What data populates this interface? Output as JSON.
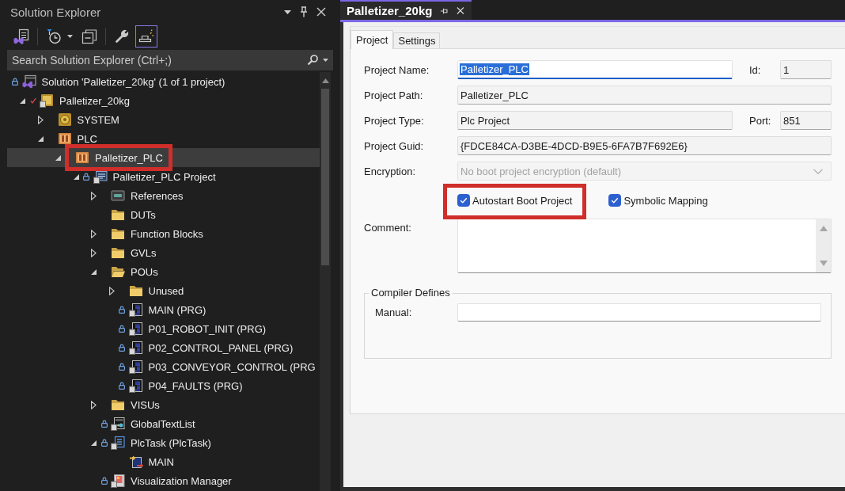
{
  "explorer": {
    "title": "Solution Explorer",
    "toolbar": [
      {
        "tools": [
          {
            "kind": "views",
            "on": false
          }
        ]
      },
      {
        "tools": [
          {
            "kind": "history",
            "on": false
          },
          {
            "kind": "collapse",
            "on": false
          }
        ]
      },
      {
        "tools": [
          {
            "kind": "properties",
            "on": false
          },
          {
            "kind": "preview",
            "on": true
          }
        ]
      }
    ],
    "search": {
      "placeholder": "Search Solution Explorer (Ctrl+;)"
    },
    "tree": [
      {
        "text": "Solution 'Palletizer_20kg' (1 of 1 project)",
        "kind": "solution",
        "locked": true,
        "ticked": false,
        "selected": false,
        "marked": false,
        "children": [
          {
            "text": "Palletizer_20kg",
            "kind": "project",
            "locked": false,
            "ticked": true,
            "expanded": true,
            "selected": false,
            "marked": false,
            "children": [
              {
                "text": "SYSTEM",
                "kind": "system",
                "locked": false,
                "ticked": false,
                "expanded": false,
                "selected": false,
                "marked": false
              },
              {
                "text": "PLC",
                "kind": "plc",
                "locked": false,
                "ticked": false,
                "expanded": true,
                "selected": false,
                "marked": false,
                "children": [
                  {
                    "text": "Palletizer_PLC",
                    "kind": "plc",
                    "locked": false,
                    "ticked": false,
                    "expanded": true,
                    "selected": true,
                    "marked": true,
                    "children": [
                      {
                        "text": "Palletizer_PLC Project",
                        "kind": "plc-project",
                        "locked": true,
                        "ticked": false,
                        "expanded": true,
                        "selected": false,
                        "marked": false,
                        "children": [
                          {
                            "text": "References",
                            "kind": "references",
                            "locked": false,
                            "ticked": false,
                            "expanded": false,
                            "selected": false,
                            "marked": false
                          },
                          {
                            "text": "DUTs",
                            "kind": "folder",
                            "locked": false,
                            "ticked": false,
                            "selected": false,
                            "marked": false
                          },
                          {
                            "text": "Function Blocks",
                            "kind": "folder",
                            "locked": false,
                            "ticked": false,
                            "expanded": false,
                            "selected": false,
                            "marked": false
                          },
                          {
                            "text": "GVLs",
                            "kind": "folder",
                            "locked": false,
                            "ticked": false,
                            "expanded": false,
                            "selected": false,
                            "marked": false
                          },
                          {
                            "text": "POUs",
                            "kind": "folder",
                            "locked": false,
                            "ticked": false,
                            "expanded": true,
                            "selected": false,
                            "marked": false,
                            "children": [
                              {
                                "text": "Unused",
                                "kind": "folder",
                                "locked": false,
                                "ticked": false,
                                "expanded": false,
                                "selected": false,
                                "marked": false
                              },
                              {
                                "text": "MAIN (PRG)",
                                "kind": "program",
                                "locked": true,
                                "ticked": false,
                                "selected": false,
                                "marked": false
                              },
                              {
                                "text": "P01_ROBOT_INIT (PRG)",
                                "kind": "program",
                                "locked": true,
                                "ticked": false,
                                "selected": false,
                                "marked": false
                              },
                              {
                                "text": "P02_CONTROL_PANEL (PRG)",
                                "kind": "program",
                                "locked": true,
                                "ticked": false,
                                "selected": false,
                                "marked": false
                              },
                              {
                                "text": "P03_CONVEYOR_CONTROL (PRG",
                                "kind": "program",
                                "locked": true,
                                "ticked": false,
                                "selected": false,
                                "marked": false
                              },
                              {
                                "text": "P04_FAULTS (PRG)",
                                "kind": "program",
                                "locked": true,
                                "ticked": false,
                                "selected": false,
                                "marked": false
                              }
                            ]
                          },
                          {
                            "text": "VISUs",
                            "kind": "folder",
                            "locked": false,
                            "ticked": false,
                            "expanded": false,
                            "selected": false,
                            "marked": false
                          },
                          {
                            "text": "GlobalTextList",
                            "kind": "text-list",
                            "locked": true,
                            "ticked": false,
                            "selected": false,
                            "marked": false
                          },
                          {
                            "text": "PlcTask (PlcTask)",
                            "kind": "task",
                            "locked": true,
                            "ticked": false,
                            "expanded": true,
                            "selected": false,
                            "marked": false,
                            "children": [
                              {
                                "text": "MAIN",
                                "kind": "task-call",
                                "locked": false,
                                "ticked": false,
                                "selected": false,
                                "marked": false
                              }
                            ]
                          },
                          {
                            "text": "Visualization Manager",
                            "kind": "visu-manager",
                            "locked": true,
                            "ticked": false,
                            "selected": false,
                            "marked": false
                          }
                        ]
                      }
                    ]
                  }
                ]
              }
            ]
          }
        ]
      }
    ]
  },
  "document": {
    "tabs": [
      {
        "title": "Palletizer_20kg",
        "selected": true
      }
    ],
    "page_tabs": [
      {
        "label": "Project",
        "selected": true
      },
      {
        "label": "Settings",
        "selected": false
      }
    ],
    "form": {
      "rows": [
        {
          "kind": "text",
          "label": "Project Name:",
          "value": "Palletizer_PLC",
          "readonly": false,
          "focused": true,
          "value_selected": true,
          "side": {
            "label": "Id:",
            "value": "1",
            "readonly": true
          }
        },
        {
          "kind": "text",
          "label": "Project Path:",
          "value": "Palletizer_PLC",
          "readonly": true,
          "focused": false,
          "value_selected": false
        },
        {
          "kind": "text",
          "label": "Project Type:",
          "value": "Plc Project",
          "readonly": true,
          "focused": false,
          "value_selected": false,
          "side": {
            "label": "Port:",
            "value": "851",
            "readonly": true
          }
        },
        {
          "kind": "text",
          "label": "Project Guid:",
          "value": "{FDCE84CA-D3BE-4DCD-B9E5-6FA7B7F692E6}",
          "readonly": true,
          "focused": false,
          "value_selected": false
        },
        {
          "kind": "dropdown",
          "label": "Encryption:",
          "value": "No boot project encryption (default)",
          "disabled": true
        },
        {
          "kind": "checks",
          "checks": [
            {
              "label": "Autostart Boot Project",
              "checked": true,
              "marked": true
            },
            {
              "label": "Symbolic Mapping",
              "checked": true,
              "marked": false
            }
          ]
        },
        {
          "kind": "textarea",
          "label": "Comment:"
        }
      ]
    },
    "group": {
      "title": "Compiler Defines",
      "fields": [
        {
          "label": "Manual:",
          "readonly": false
        }
      ]
    }
  }
}
